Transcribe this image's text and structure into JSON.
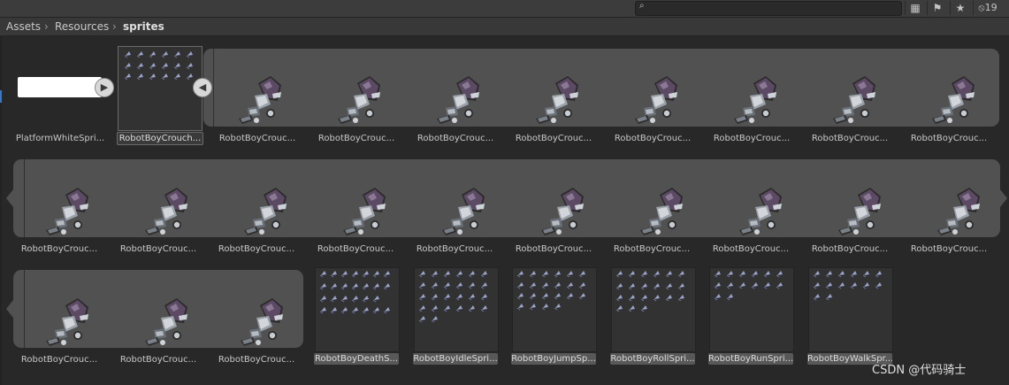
{
  "toolbar": {
    "search_placeholder": "",
    "filter_count": "19",
    "icons": [
      "search-icon",
      "filter-by-type-icon",
      "filter-by-label-icon",
      "favorite-star-icon",
      "hidden-packages-icon"
    ]
  },
  "breadcrumb": {
    "items": [
      "Assets",
      "Resources",
      "sprites"
    ]
  },
  "assets": {
    "platform_white": "PlatformWhiteSpri...",
    "crouch_sheet": "RobotBoyCrouch...",
    "crouch_frame": "RobotBoyCrouc...",
    "death": "RobotBoyDeathS...",
    "idle": "RobotBoyIdleSpri...",
    "jump": "RobotBoyJumpSp...",
    "roll": "RobotBoyRollSpri...",
    "run": "RobotBoyRunSpri...",
    "walk": "RobotBoyWalkSpr..."
  },
  "watermark": "CSDN @代码骑士",
  "colors": {
    "selection_accent": "#3a78c6",
    "sprite_helmet": "#5c4a64"
  }
}
